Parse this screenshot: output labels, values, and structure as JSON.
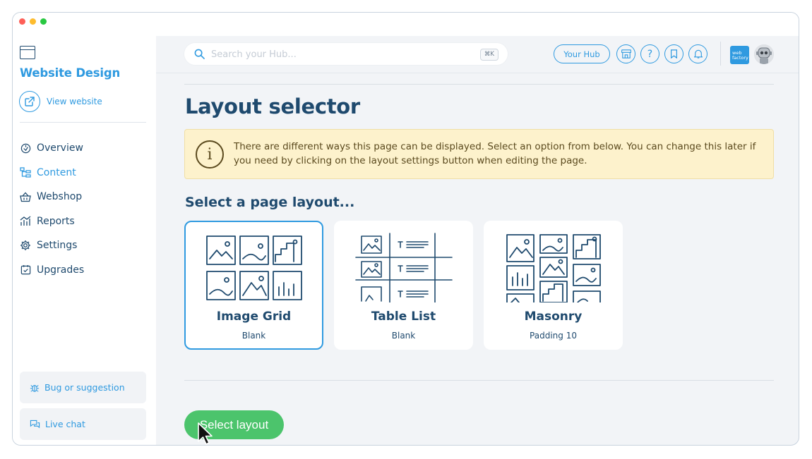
{
  "window": {
    "controls": [
      "close",
      "minimize",
      "maximize"
    ]
  },
  "sidebar": {
    "site_icon": "browser-window-icon",
    "site_title": "Website Design",
    "view_website_label": "View website",
    "items": [
      {
        "label": "Overview",
        "icon": "overview-icon",
        "active": false
      },
      {
        "label": "Content",
        "icon": "content-tree-icon",
        "active": true
      },
      {
        "label": "Webshop",
        "icon": "basket-icon",
        "active": false
      },
      {
        "label": "Reports",
        "icon": "chart-icon",
        "active": false
      },
      {
        "label": "Settings",
        "icon": "gear-icon",
        "active": false
      },
      {
        "label": "Upgrades",
        "icon": "calendar-check-icon",
        "active": false
      }
    ],
    "bug_label": "Bug or suggestion",
    "chat_label": "Live chat"
  },
  "topbar": {
    "search_placeholder": "Search your Hub...",
    "search_shortcut": "⌘K",
    "hub_label": "Your Hub",
    "icons": [
      "store-icon",
      "help-icon",
      "bookmark-icon",
      "bell-icon"
    ],
    "logo_text": "web factory"
  },
  "main": {
    "title": "Layout selector",
    "notice": "There are different ways this page can be displayed. Select an option from below. You can change this later if you need by clicking on the layout settings button when editing the page.",
    "section_title": "Select a page layout...",
    "layouts": [
      {
        "name": "Image Grid",
        "subtitle": "Blank",
        "selected": true
      },
      {
        "name": "Table List",
        "subtitle": "Blank",
        "selected": false
      },
      {
        "name": "Masonry",
        "subtitle": "Padding 10",
        "selected": false
      }
    ],
    "primary_button": "Select layout"
  },
  "colors": {
    "accent": "#2f9ae0",
    "navy": "#1f4a6e",
    "success": "#4cc46c",
    "notice_bg": "#fdf2cc",
    "notice_text": "#5b4a1e"
  }
}
